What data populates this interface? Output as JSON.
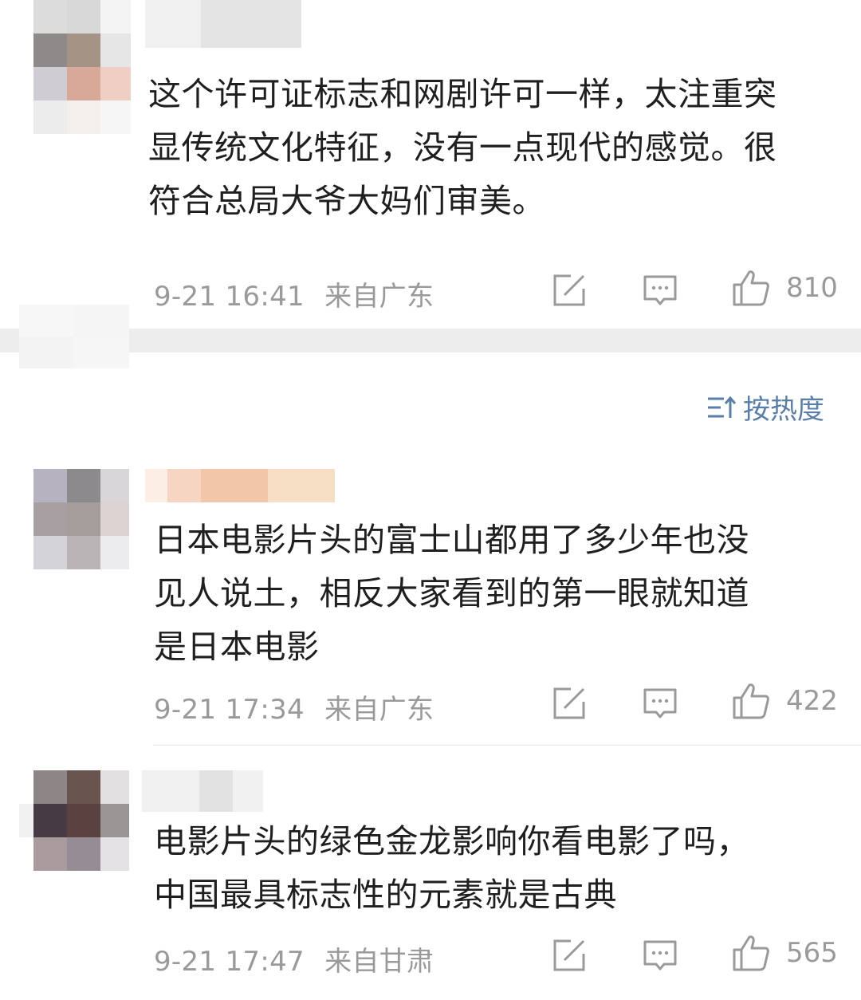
{
  "comments": [
    {
      "text": "这个许可证标志和网剧许可一样，太注重突\n显传统文化特征，没有一点现代的感觉。很\n符合总局大爷大妈们审美。",
      "time": "9-21 16:41",
      "source": "来自广东",
      "likes": "810"
    },
    {
      "text": "日本电影片头的富士山都用了多少年也没\n见人说土，相反大家看到的第一眼就知道\n是日本电影",
      "time": "9-21 17:34",
      "source": "来自广东",
      "likes": "422"
    },
    {
      "text": "电影片头的绿色金龙影响你看电影了吗，\n中国最具标志性的元素就是古典",
      "time": "9-21 17:47",
      "source": "来自甘肃",
      "likes": "565"
    }
  ],
  "sort": {
    "label": "按热度",
    "icon": "sort-icon"
  },
  "icons": {
    "repost": "repost-icon",
    "comment": "comment-icon",
    "like": "thumbs-up-icon"
  },
  "colors": {
    "text": "#1f1f1f",
    "meta": "#9a9a9a",
    "sort_accent": "#5a7eaa",
    "separator": "#ededed"
  }
}
